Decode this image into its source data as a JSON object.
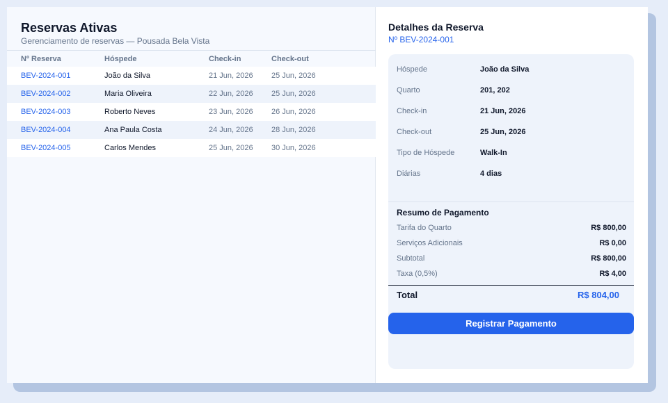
{
  "list": {
    "title": "Reservas Ativas",
    "subtitle": "Gerenciamento de reservas — Pousada Bela Vista",
    "columns": [
      "Nº Reserva",
      "Hóspede",
      "Check-in",
      "Check-out"
    ],
    "rows": [
      {
        "id": "BEV-2024-001",
        "guest": "João da Silva",
        "checkin": "21 Jun, 2026",
        "checkout": "25 Jun, 2026"
      },
      {
        "id": "BEV-2024-002",
        "guest": "Maria Oliveira",
        "checkin": "22 Jun, 2026",
        "checkout": "25 Jun, 2026"
      },
      {
        "id": "BEV-2024-003",
        "guest": "Roberto Neves",
        "checkin": "23 Jun, 2026",
        "checkout": "26 Jun, 2026"
      },
      {
        "id": "BEV-2024-004",
        "guest": "Ana Paula Costa",
        "checkin": "24 Jun, 2026",
        "checkout": "28 Jun, 2026"
      },
      {
        "id": "BEV-2024-005",
        "guest": "Carlos Mendes",
        "checkin": "25 Jun, 2026",
        "checkout": "30 Jun, 2026"
      }
    ]
  },
  "details": {
    "title": "Detalhes da Reserva",
    "reservation_number": "Nº BEV-2024-001",
    "fields": [
      {
        "label": "Hóspede",
        "value": "João da Silva"
      },
      {
        "label": "Quarto",
        "value": "201, 202"
      },
      {
        "label": "Check-in",
        "value": "21 Jun, 2026"
      },
      {
        "label": "Check-out",
        "value": "25 Jun, 2026"
      },
      {
        "label": "Tipo de Hóspede",
        "value": "Walk-In"
      },
      {
        "label": "Diárias",
        "value": "4 dias"
      }
    ],
    "payment": {
      "title": "Resumo de Pagamento",
      "lines": [
        {
          "label": "Tarifa do Quarto",
          "value": "R$ 800,00"
        },
        {
          "label": "Serviços Adicionais",
          "value": "R$ 0,00"
        },
        {
          "label": "Subtotal",
          "value": "R$ 800,00"
        },
        {
          "label": "Taxa (0,5%)",
          "value": "R$ 4,00"
        }
      ],
      "total_label": "Total",
      "total_value": "R$ 804,00"
    },
    "button_label": "Registrar Pagamento"
  },
  "colors": {
    "accent": "#2563eb",
    "page_background": "#e6edf9",
    "panel_background": "#eef3fb"
  }
}
